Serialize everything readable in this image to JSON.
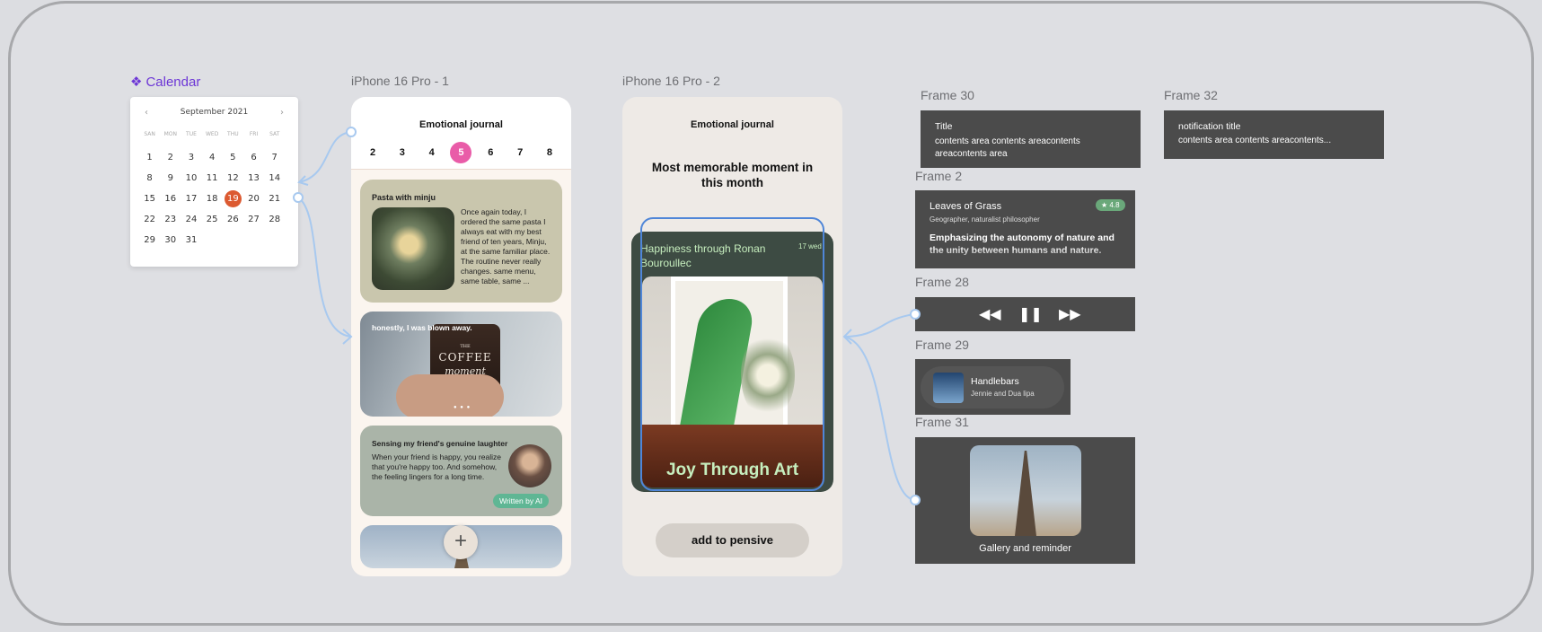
{
  "labels": {
    "calendar": "Calendar",
    "phone1": "iPhone 16 Pro - 1",
    "phone2": "iPhone 16 Pro - 2",
    "frame30": "Frame 30",
    "frame32": "Frame 32",
    "frame2": "Frame 2",
    "frame28": "Frame 28",
    "frame29": "Frame 29",
    "frame31": "Frame 31"
  },
  "calendar": {
    "month": "September 2021",
    "prev": "‹",
    "next": "›",
    "weekdays": [
      "SAN",
      "MON",
      "TUE",
      "WED",
      "THU",
      "FRI",
      "SAT"
    ],
    "days": [
      "1",
      "2",
      "3",
      "4",
      "5",
      "6",
      "7",
      "8",
      "9",
      "10",
      "11",
      "12",
      "13",
      "14",
      "15",
      "16",
      "17",
      "18",
      "19",
      "20",
      "21",
      "22",
      "23",
      "24",
      "25",
      "26",
      "27",
      "28",
      "29",
      "30",
      "31"
    ],
    "selected": "19"
  },
  "phone1": {
    "title": "Emotional journal",
    "dates": [
      "2",
      "3",
      "4",
      "5",
      "6",
      "7",
      "8"
    ],
    "active_date": "5",
    "card1_title": "Pasta with minju",
    "card1_body": "Once again today, I ordered the same pasta I always eat with my best friend of ten years, Minju, at the same familiar place. The routine never really changes. same menu, same table, same ...",
    "card2_text": "honestly, I was blown away.",
    "card2_cup_small": "THE",
    "card2_cup_big": "COFFEE",
    "card2_cup_script": "moment",
    "card2_dots": "● ● ●",
    "card3_title": "Sensing my friend's genuine laughter",
    "card3_body": "When your friend is happy, you realize that you're happy too. And somehow, the feeling lingers for a long time.",
    "card3_badge": "Written by AI",
    "plus": "+"
  },
  "phone2": {
    "title": "Emotional journal",
    "heading": "Most memorable moment in this month",
    "card_title": "Happiness through Ronan Bouroullec",
    "card_date": "17 wed",
    "card_caption": "Joy Through Art",
    "button": "add to pensive"
  },
  "frame30": {
    "title": "Title",
    "body": "contents area contents areacontents areacontents area"
  },
  "frame32": {
    "title": "notification title",
    "body": "contents area contents areacontents..."
  },
  "frame2": {
    "title": "Leaves of Grass",
    "subtitle": "Geographer, naturalist philosopher",
    "rating": "★ 4.8",
    "quote": "Emphasizing the autonomy of nature and the unity between humans and nature."
  },
  "frame28": {
    "rewind": "◀◀",
    "pause": "❚❚",
    "forward": "▶▶"
  },
  "frame29": {
    "song": "Handlebars",
    "artist": "Jennie and Dua lipa"
  },
  "frame31": {
    "caption": "Gallery and reminder"
  }
}
